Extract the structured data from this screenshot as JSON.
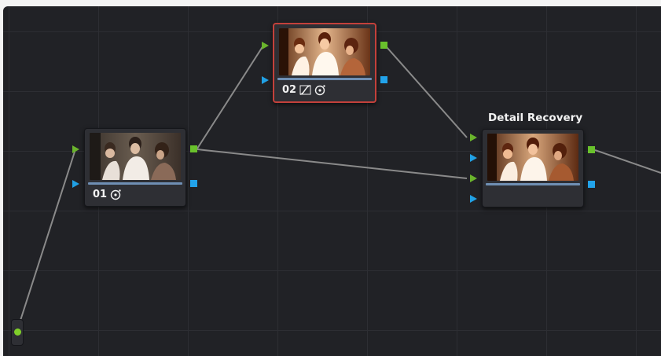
{
  "node_editor": {
    "nodes": [
      {
        "id": "01",
        "label": "01",
        "tools": [
          "color-warper-icon"
        ]
      },
      {
        "id": "02",
        "label": "02",
        "tools": [
          "curves-icon",
          "color-warper-icon"
        ],
        "selected": true
      },
      {
        "id": "detail-recovery",
        "label": "",
        "title": "Detail Recovery",
        "tools": []
      }
    ],
    "colors": {
      "canvas": "#212226",
      "grid": "#2d2e33",
      "rgb_port": "#6ab42c",
      "alpha_port": "#21a1e5",
      "selection_outline": "#c3413b",
      "wire": "#8a8a8a"
    }
  }
}
